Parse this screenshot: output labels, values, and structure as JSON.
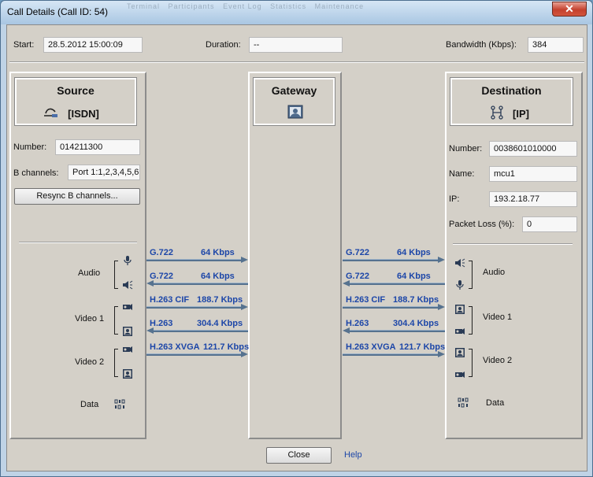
{
  "window": {
    "title": "Call Details  (Call ID: 54)",
    "close_glyph": "✕",
    "ghost_tabs": [
      "Terminal",
      "Participants",
      "Event Log",
      "Statistics",
      "Maintenance"
    ]
  },
  "top": {
    "start_label": "Start:",
    "start_value": "28.5.2012 15:00:09",
    "duration_label": "Duration:",
    "duration_value": "--",
    "bandwidth_label": "Bandwidth (Kbps):",
    "bandwidth_value": "384"
  },
  "source": {
    "title": "Source",
    "type": "[ISDN]",
    "number_label": "Number:",
    "number_value": "014211300",
    "bchannels_label": "B channels:",
    "bchannels_value": "Port 1:1,2,3,4,5,6",
    "resync_label": "Resync B channels...",
    "audio_label": "Audio",
    "video1_label": "Video 1",
    "video2_label": "Video 2",
    "data_label": "Data"
  },
  "gateway": {
    "title": "Gateway"
  },
  "destination": {
    "title": "Destination",
    "type": "[IP]",
    "number_label": "Number:",
    "number_value": "0038601010000",
    "name_label": "Name:",
    "name_value": "mcu1",
    "ip_label": "IP:",
    "ip_value": "193.2.18.77",
    "packet_loss_label": "Packet Loss (%):",
    "packet_loss_value": "0",
    "audio_label": "Audio",
    "video1_label": "Video 1",
    "video2_label": "Video 2",
    "data_label": "Data"
  },
  "left_streams": [
    {
      "codec": "G.722",
      "rate": "64 Kbps",
      "direction": "right"
    },
    {
      "codec": "G.722",
      "rate": "64 Kbps",
      "direction": "left"
    },
    {
      "codec": "H.263 CIF",
      "rate": "188.7 Kbps",
      "direction": "right"
    },
    {
      "codec": "H.263",
      "rate": "304.4 Kbps",
      "direction": "left"
    },
    {
      "codec": "H.263 XVGA",
      "rate": "121.7 Kbps",
      "direction": "right"
    }
  ],
  "right_streams": [
    {
      "codec": "G.722",
      "rate": "64 Kbps",
      "direction": "right"
    },
    {
      "codec": "G.722",
      "rate": "64 Kbps",
      "direction": "left"
    },
    {
      "codec": "H.263 CIF",
      "rate": "188.7 Kbps",
      "direction": "right"
    },
    {
      "codec": "H.263",
      "rate": "304.4 Kbps",
      "direction": "left"
    },
    {
      "codec": "H.263 XVGA",
      "rate": "121.7 Kbps",
      "direction": "right"
    }
  ],
  "footer": {
    "close_label": "Close",
    "help_label": "Help"
  },
  "colors": {
    "codec_text": "#1c46a8",
    "arrow": "#56728f",
    "panel_bg": "#d4d0c8",
    "title_bar": "#bfd3e6"
  }
}
